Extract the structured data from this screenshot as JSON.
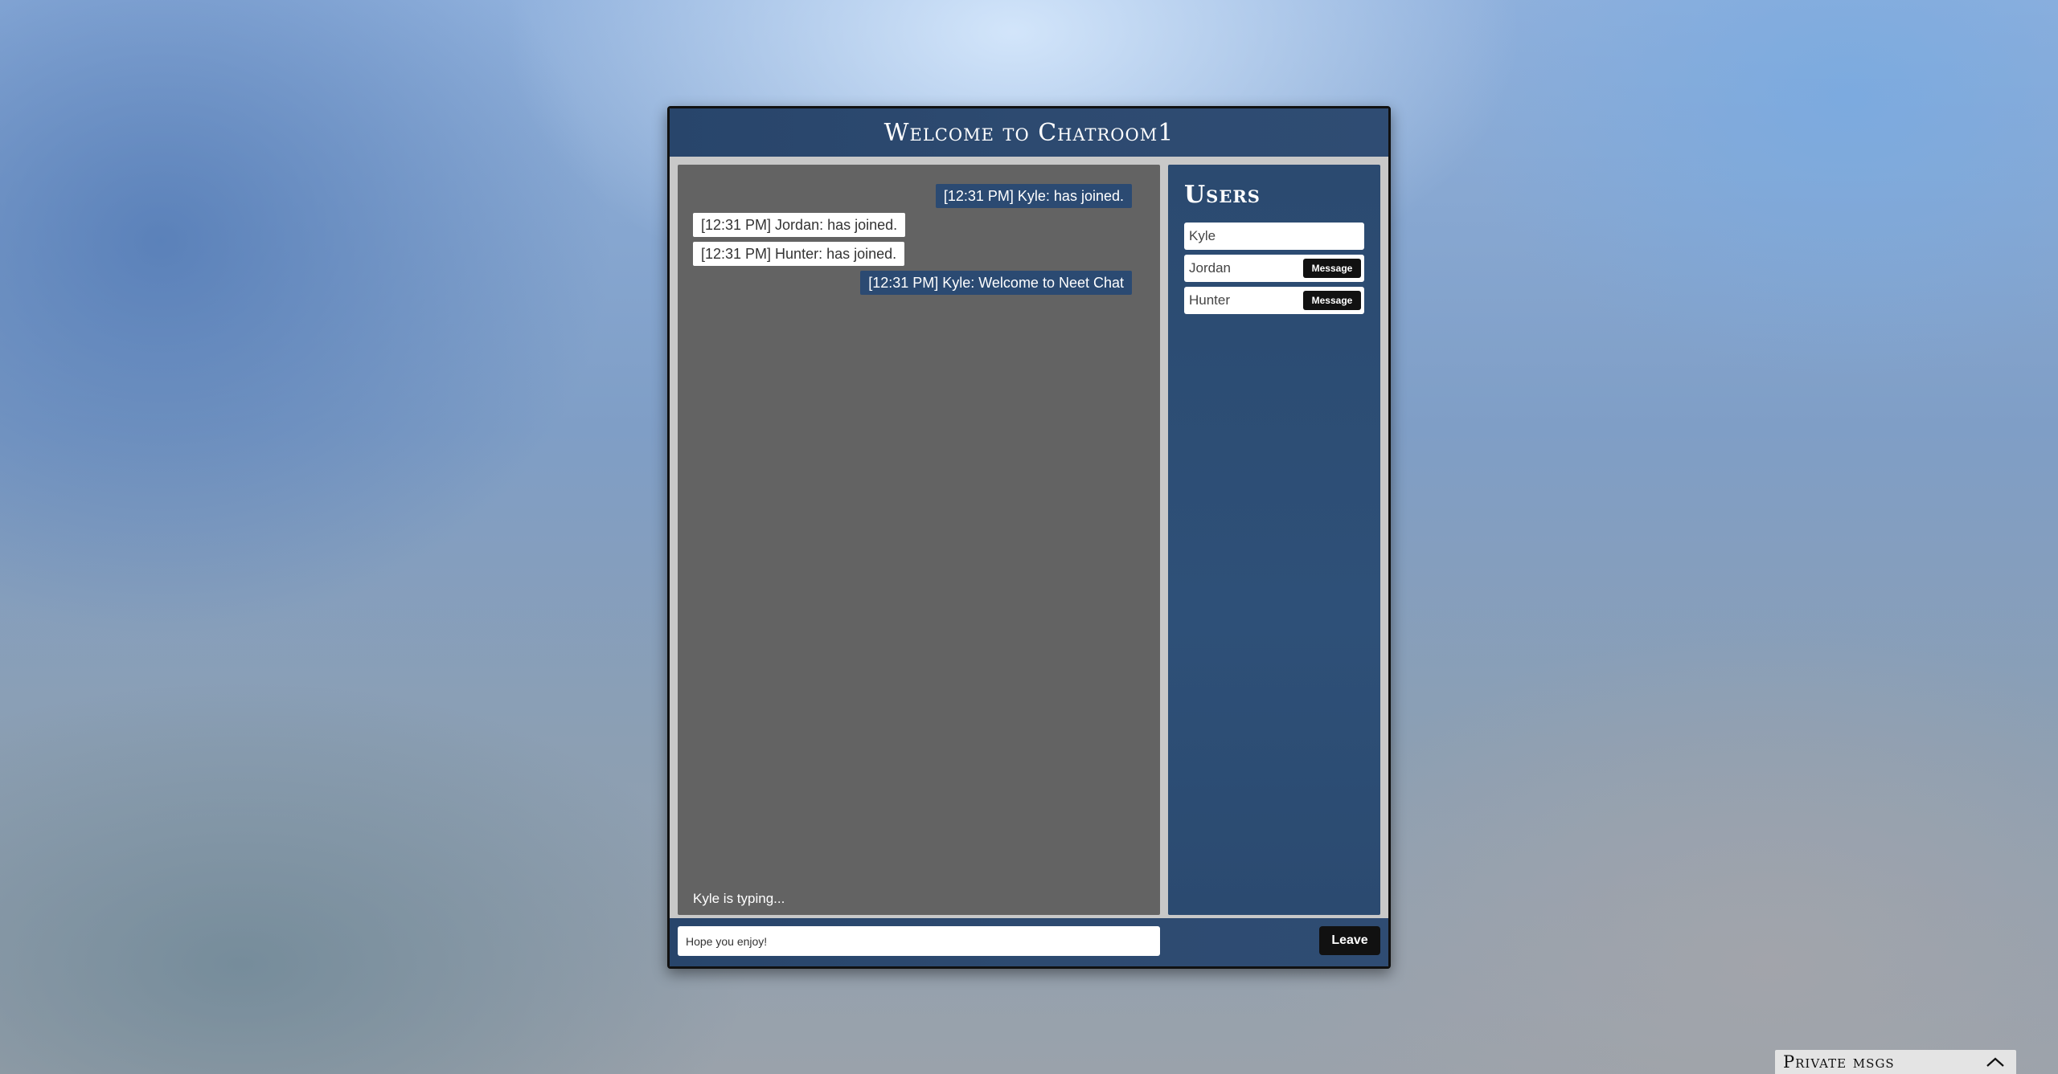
{
  "header": {
    "title": "Welcome to Chatroom1"
  },
  "messages": [
    {
      "text": "[12:31 PM] Kyle: has joined.",
      "own": true
    },
    {
      "text": "[12:31 PM] Jordan: has joined.",
      "own": false
    },
    {
      "text": "[12:31 PM] Hunter: has joined.",
      "own": false
    },
    {
      "text": "[12:31 PM] Kyle: Welcome to Neet Chat",
      "own": true
    }
  ],
  "typing_indicator": "Kyle is typing...",
  "users": {
    "title": "Users",
    "list": [
      {
        "name": "Kyle",
        "message_button": null
      },
      {
        "name": "Jordan",
        "message_button": "Message"
      },
      {
        "name": "Hunter",
        "message_button": "Message"
      }
    ]
  },
  "footer": {
    "input_value": "Hope you enjoy!",
    "leave_label": "Leave"
  },
  "private_messages": {
    "label": "Private msgs",
    "toggle_icon": "chevron-up-icon"
  },
  "colors": {
    "panel_blue": "#2b4a70",
    "message_area_gray": "#636363",
    "button_black": "#111111"
  }
}
